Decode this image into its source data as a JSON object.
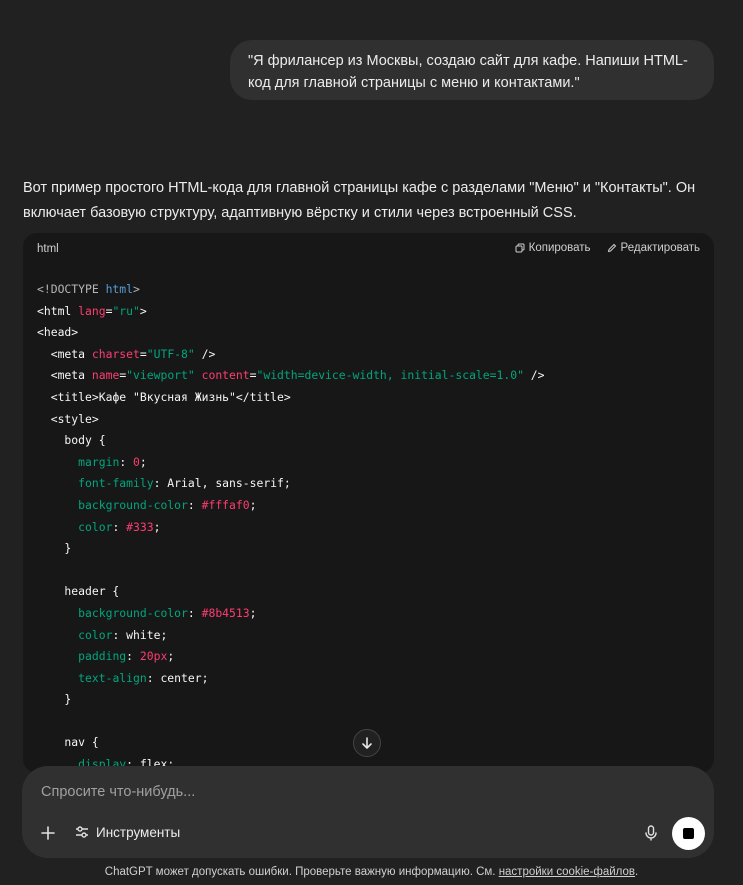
{
  "conversation": {
    "user_message": "\"Я фрилансер из Москвы, создаю сайт для кафе. Напиши HTML-код для главной страницы с меню и контактами.\"",
    "assistant_intro": "Вот пример простого HTML-кода для главной страницы кафе с разделами \"Меню\" и \"Контакты\". Он включает базовую структуру, адаптивную вёрстку и стили через встроенный CSS."
  },
  "code_block": {
    "language": "html",
    "copy_label": "Копировать",
    "edit_label": "Редактировать",
    "tokens": [
      [
        [
          "doc",
          "<!DOCTYPE "
        ],
        [
          "kw",
          "html"
        ],
        [
          "doc",
          ">"
        ]
      ],
      [
        [
          "tag",
          "<html "
        ],
        [
          "attr",
          "lang"
        ],
        [
          "tag",
          "="
        ],
        [
          "str",
          "\"ru\""
        ],
        [
          "tag",
          ">"
        ]
      ],
      [
        [
          "tag",
          "<head>"
        ]
      ],
      [
        [
          "tag",
          "  <meta "
        ],
        [
          "attr",
          "charset"
        ],
        [
          "tag",
          "="
        ],
        [
          "str",
          "\"UTF-8\""
        ],
        [
          "tag",
          " />"
        ]
      ],
      [
        [
          "tag",
          "  <meta "
        ],
        [
          "attr",
          "name"
        ],
        [
          "tag",
          "="
        ],
        [
          "str",
          "\"viewport\""
        ],
        [
          "tag",
          " "
        ],
        [
          "attr",
          "content"
        ],
        [
          "tag",
          "="
        ],
        [
          "str",
          "\"width=device-width, initial-scale=1.0\""
        ],
        [
          "tag",
          " />"
        ]
      ],
      [
        [
          "tag",
          "  <title>"
        ],
        [
          "val",
          "Кафе \"Вкусная Жизнь\""
        ],
        [
          "tag",
          "</title>"
        ]
      ],
      [
        [
          "tag",
          "  <style>"
        ]
      ],
      [
        [
          "val",
          "    body {"
        ]
      ],
      [
        [
          "val",
          "      "
        ],
        [
          "prop",
          "margin"
        ],
        [
          "val",
          ": "
        ],
        [
          "num",
          "0"
        ],
        [
          "val",
          ";"
        ]
      ],
      [
        [
          "val",
          "      "
        ],
        [
          "prop",
          "font-family"
        ],
        [
          "val",
          ": Arial, sans-serif;"
        ]
      ],
      [
        [
          "val",
          "      "
        ],
        [
          "prop",
          "background-color"
        ],
        [
          "val",
          ": "
        ],
        [
          "num",
          "#fffaf0"
        ],
        [
          "val",
          ";"
        ]
      ],
      [
        [
          "val",
          "      "
        ],
        [
          "prop",
          "color"
        ],
        [
          "val",
          ": "
        ],
        [
          "num",
          "#333"
        ],
        [
          "val",
          ";"
        ]
      ],
      [
        [
          "val",
          "    }"
        ]
      ],
      [
        [
          "val",
          ""
        ]
      ],
      [
        [
          "val",
          "    header {"
        ]
      ],
      [
        [
          "val",
          "      "
        ],
        [
          "prop",
          "background-color"
        ],
        [
          "val",
          ": "
        ],
        [
          "num",
          "#8b4513"
        ],
        [
          "val",
          ";"
        ]
      ],
      [
        [
          "val",
          "      "
        ],
        [
          "prop",
          "color"
        ],
        [
          "val",
          ": white;"
        ]
      ],
      [
        [
          "val",
          "      "
        ],
        [
          "prop",
          "padding"
        ],
        [
          "val",
          ": "
        ],
        [
          "num",
          "20px"
        ],
        [
          "val",
          ";"
        ]
      ],
      [
        [
          "val",
          "      "
        ],
        [
          "prop",
          "text-align"
        ],
        [
          "val",
          ": center;"
        ]
      ],
      [
        [
          "val",
          "    }"
        ]
      ],
      [
        [
          "val",
          ""
        ]
      ],
      [
        [
          "val",
          "    nav {"
        ]
      ],
      [
        [
          "val",
          "      "
        ],
        [
          "prop",
          "display"
        ],
        [
          "val",
          ": flex;"
        ]
      ]
    ]
  },
  "composer": {
    "placeholder": "Спросите что-нибудь...",
    "tools_label": "Инструменты"
  },
  "footer": {
    "text": "ChatGPT может допускать ошибки. Проверьте важную информацию. См. ",
    "link": "настройки cookie-файлов",
    "end": "."
  },
  "icons": {
    "copy": "copy-icon",
    "edit": "edit-icon",
    "scroll_down": "arrow-down-icon",
    "plus": "plus-icon",
    "tools": "sliders-icon",
    "mic": "mic-icon",
    "stop": "stop-icon"
  },
  "colors": {
    "background": "#212121",
    "bubble": "#303030",
    "code_bg": "#171717",
    "attr": "#ff3d71",
    "string": "#00a67d",
    "keyword": "#569cd6"
  }
}
